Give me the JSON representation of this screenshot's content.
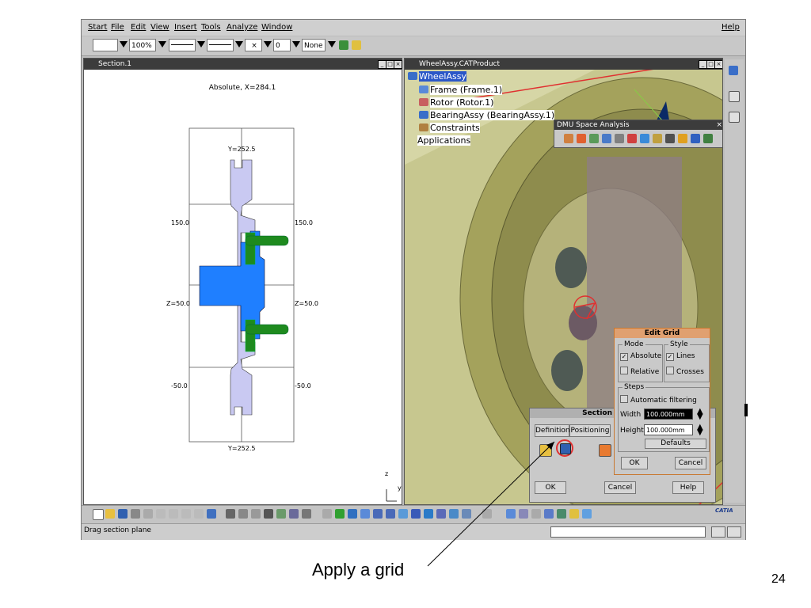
{
  "menubar": {
    "items": [
      "Start",
      "File",
      "Edit",
      "View",
      "Insert",
      "Tools",
      "Analyze",
      "Window"
    ],
    "help": "Help"
  },
  "toolbar": {
    "zoom": "100%",
    "layer": "None",
    "cross": "×",
    "small_value": "0"
  },
  "section_window": {
    "title": "Section.1",
    "header": "Absolute, X=284.1",
    "labels": {
      "y_top": "Y=252.5",
      "y_bottom": "Y=252.5",
      "l150": "150.0",
      "r150": "150.0",
      "lz50": "Z=50.0",
      "rz50": "Z=50.0",
      "lm50": "-50.0",
      "rm50": "-50.0"
    },
    "axis_z": "z",
    "axis_y": "y"
  },
  "product_window": {
    "title": "WheelAssy.CATProduct",
    "tree": [
      "WheelAssy",
      "Frame (Frame.1)",
      "Rotor (Rotor.1)",
      "BearingAssy (BearingAssy.1)",
      "Constraints",
      "Applications"
    ]
  },
  "dmu_toolbar": {
    "title": "DMU Space Analysis"
  },
  "edit_grid": {
    "title": "Edit Grid",
    "mode_label": "Mode",
    "style_label": "Style",
    "absolute": "Absolute",
    "relative": "Relative",
    "lines": "Lines",
    "crosses": "Crosses",
    "steps_label": "Steps",
    "automatic_filtering": "Automatic filtering",
    "width_label": "Width",
    "width_value": "100.000mm",
    "height_label": "Height",
    "height_value": "100.000mm",
    "defaults": "Defaults",
    "ok": "OK",
    "cancel": "Cancel"
  },
  "section_dialog": {
    "title": "Section",
    "tab_definition": "Definition",
    "tab_positioning": "Positioning",
    "ok": "OK",
    "cancel": "Cancel",
    "help": "Help"
  },
  "statusbar": {
    "message": "Drag section plane"
  },
  "slide": {
    "caption": "Apply a grid",
    "page_number": "24"
  },
  "logo": "CATIA",
  "colors": {
    "blue_part": "#1f7fff",
    "light_part": "#c9c9f2",
    "green_bolt": "#1e8a1e",
    "viewport_bg": "#9a9a5e",
    "highlight_red": "#e03030"
  }
}
